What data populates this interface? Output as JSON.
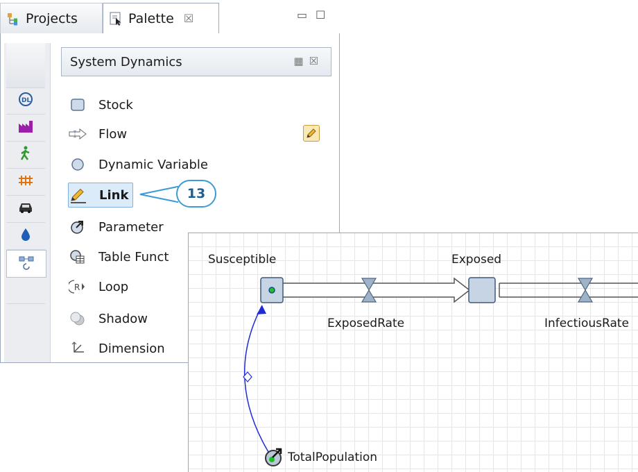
{
  "tabs": {
    "projects_label": "Projects",
    "palette_label": "Palette",
    "close_glyph": "☒"
  },
  "window_controls": {
    "minimize": "▭",
    "maximize": "☐"
  },
  "section": {
    "title": "System Dynamics",
    "view_glyph": "▦",
    "close_glyph": "☒"
  },
  "palette_items": [
    {
      "label": "Stock",
      "icon": "stock-icon"
    },
    {
      "label": "Flow",
      "icon": "flow-icon"
    },
    {
      "label": "Dynamic Variable",
      "icon": "dynamic-variable-icon"
    },
    {
      "label": "Link",
      "icon": "link-pencil-icon",
      "selected": true
    },
    {
      "label": "Parameter",
      "icon": "parameter-icon"
    },
    {
      "label": "Table Funct",
      "icon": "table-function-icon"
    },
    {
      "label": "Loop",
      "icon": "loop-icon"
    },
    {
      "label": "Shadow",
      "icon": "shadow-icon"
    },
    {
      "label": "Dimension",
      "icon": "dimension-icon"
    }
  ],
  "sidebar_icons": [
    "blank",
    "dl-icon",
    "factory-icon",
    "pedestrian-icon",
    "rail-icon",
    "car-icon",
    "drop-icon",
    "sd-icon"
  ],
  "callout": {
    "number": "13"
  },
  "diagram": {
    "stock_1": "Susceptible",
    "stock_2": "Exposed",
    "flow_1": "ExposedRate",
    "flow_2": "InfectiousRate",
    "parameter": "TotalPopulation"
  },
  "colors": {
    "accent": "#3c9bd6",
    "link_line": "#1f2bd6",
    "selection": "#dcebfa"
  }
}
